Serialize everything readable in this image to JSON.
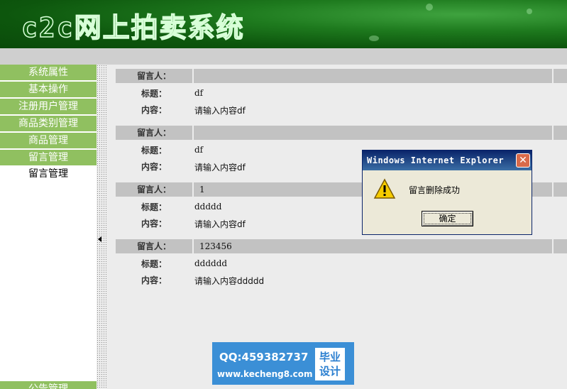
{
  "banner": {
    "title": "c2c网上拍卖系统"
  },
  "sidebar": {
    "items": [
      {
        "label": "系统属性"
      },
      {
        "label": "基本操作"
      },
      {
        "label": "注册用户管理"
      },
      {
        "label": "商品类别管理"
      },
      {
        "label": "商品管理"
      },
      {
        "label": "留言管理"
      }
    ],
    "sub_item": {
      "label": "留言管理"
    },
    "bottom_item": {
      "label": "公告管理"
    }
  },
  "messages": [
    {
      "author_label": "留言人：",
      "author": "",
      "title_label": "标题：",
      "title": "df",
      "content_label": "内容：",
      "content": "请输入内容df"
    },
    {
      "author_label": "留言人：",
      "author": "",
      "title_label": "标题：",
      "title": "df",
      "content_label": "内容：",
      "content": "请输入内容df"
    },
    {
      "author_label": "留言人：",
      "author": "1",
      "title_label": "标题：",
      "title": "ddddd",
      "content_label": "内容：",
      "content": "请输入内容df"
    },
    {
      "author_label": "留言人：",
      "author": "123456",
      "title_label": "标题：",
      "title": "dddddd",
      "content_label": "内容：",
      "content": "请输入内容ddddd"
    }
  ],
  "dialog": {
    "title": "Windows Internet Explorer",
    "close_glyph": "✕",
    "message": "留言删除成功",
    "ok_label": "确定",
    "icon": "warning-icon"
  },
  "watermark": {
    "qq": "QQ:459382737",
    "url": "www.kecheng8.com",
    "badge_line1": "毕业",
    "badge_line2": "设计"
  },
  "colors": {
    "banner_green": "#0d560d",
    "menu_green": "#90c060",
    "header_gray": "#c2c2c2",
    "dialog_title_blue": "#0a246a",
    "watermark_blue": "#3b8fd6"
  }
}
